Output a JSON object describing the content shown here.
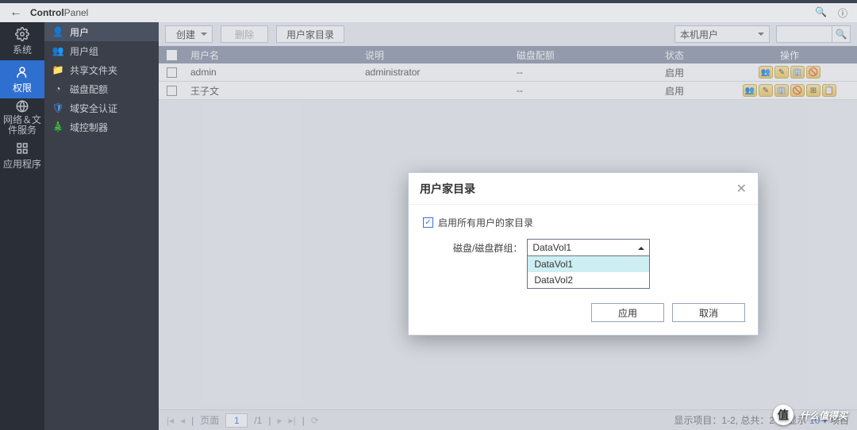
{
  "header": {
    "app_name_bold": "Control",
    "app_name_light": "Panel"
  },
  "rail": [
    {
      "id": "system",
      "label": "系统"
    },
    {
      "id": "permission",
      "label": "权限"
    },
    {
      "id": "network",
      "label": "网络＆文件服务"
    },
    {
      "id": "apps",
      "label": "应用程序"
    }
  ],
  "rail_active": "permission",
  "sidebar": {
    "items": [
      {
        "id": "user",
        "label": "用户"
      },
      {
        "id": "usergroup",
        "label": "用户组"
      },
      {
        "id": "sharedfolder",
        "label": "共享文件夹"
      },
      {
        "id": "quota",
        "label": "磁盘配额"
      },
      {
        "id": "domainsec",
        "label": "域安全认证"
      },
      {
        "id": "domainctrl",
        "label": "域控制器"
      }
    ],
    "active": "user"
  },
  "toolbar": {
    "create": "创建",
    "delete": "删除",
    "home": "用户家目录",
    "scope_select": "本机用户"
  },
  "table": {
    "headers": {
      "username": "用户名",
      "desc": "说明",
      "quota": "磁盘配额",
      "status": "状态",
      "ops": "操作"
    },
    "rows": [
      {
        "username": "admin",
        "desc": "administrator",
        "quota": "--",
        "status": "启用",
        "extra_ops": false
      },
      {
        "username": "王子文",
        "desc": "",
        "quota": "--",
        "status": "启用",
        "extra_ops": true
      }
    ]
  },
  "footer": {
    "page_label": "页面",
    "page_current": "1",
    "page_total": "/1",
    "status_left": "显示项目：",
    "status_range": "1-2,",
    "status_total_label": "总共：",
    "status_total": "2",
    "show_label": "显示",
    "page_size": "10",
    "item_label": "项目"
  },
  "modal": {
    "title": "用户家目录",
    "enable_label": "启用所有用户的家目录",
    "volume_label": "磁盘/磁盘群组：",
    "selected": "DataVol1",
    "options": [
      "DataVol1",
      "DataVol2"
    ],
    "apply": "应用",
    "cancel": "取消"
  },
  "watermark": {
    "text": "什么值得买",
    "badge": "值"
  }
}
